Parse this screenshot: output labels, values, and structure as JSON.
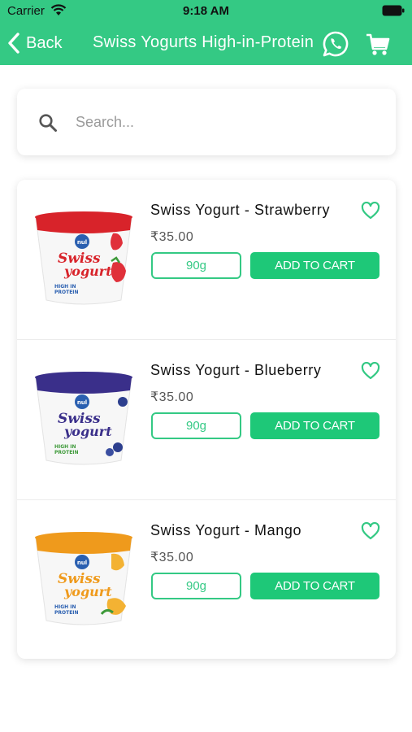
{
  "status_bar": {
    "carrier": "Carrier",
    "time": "9:18 AM"
  },
  "nav": {
    "back_label": "Back",
    "title": "Swiss Yogurts High-in-Protein",
    "accent_color": "#34c984"
  },
  "search": {
    "placeholder": "Search..."
  },
  "products": [
    {
      "name": "Swiss Yogurt - Strawberry",
      "price": "₹35.00",
      "size": "90g",
      "add_label": "ADD TO CART",
      "flavor_color": "#d8232a",
      "fruit_color": "#e0303a",
      "image_icon": "strawberry-yogurt-cup"
    },
    {
      "name": "Swiss Yogurt - Blueberry",
      "price": "₹35.00",
      "size": "90g",
      "add_label": "ADD TO CART",
      "flavor_color": "#3a2f8a",
      "fruit_color": "#2d3f8e",
      "image_icon": "blueberry-yogurt-cup"
    },
    {
      "name": "Swiss Yogurt - Mango",
      "price": "₹35.00",
      "size": "90g",
      "add_label": "ADD TO CART",
      "flavor_color": "#ef9a1c",
      "fruit_color": "#f3b233",
      "image_icon": "mango-yogurt-cup"
    }
  ]
}
